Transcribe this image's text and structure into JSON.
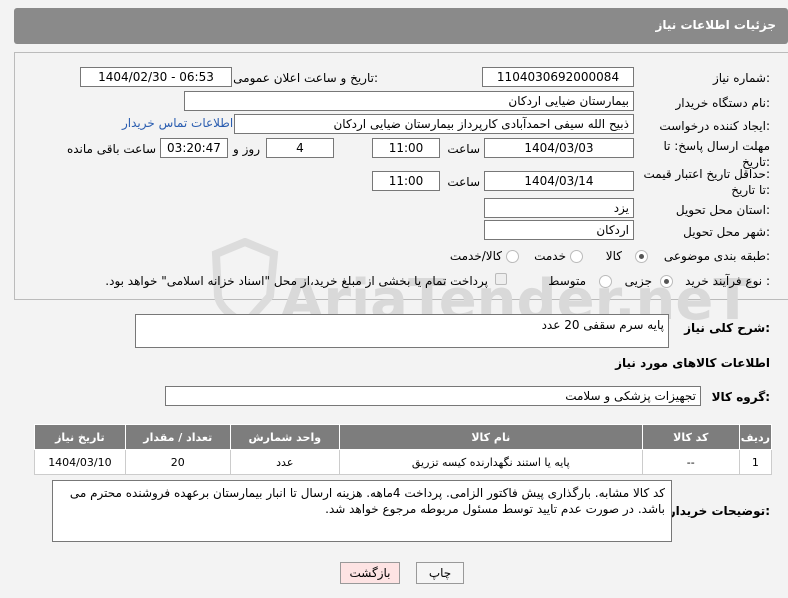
{
  "header": {
    "title": "جزئیات اطلاعات نیاز"
  },
  "fields": {
    "need_number_label": "شماره نیاز:",
    "need_number": "1104030692000084",
    "announce_label": "تاریخ و ساعت اعلان عمومی:",
    "announce_value": "1404/02/30 - 06:53",
    "buyer_org_label": "نام دستگاه خریدار:",
    "buyer_org": "بیمارستان ضیایی اردکان",
    "creator_label": "ایجاد کننده درخواست:",
    "creator": "ذبیح الله سیفی احمدآبادی کارپرداز بیمارستان ضیایی اردکان",
    "contact_link": "اطلاعات تماس خریدار",
    "deadline_label_1": "مهلت ارسال پاسخ: تا",
    "deadline_label_2": "تاریخ:",
    "deadline_date": "1404/03/03",
    "time_label": "ساعت",
    "deadline_time": "11:00",
    "days_value": "4",
    "days_label": "روز و",
    "remaining_value": "03:20:47",
    "remaining_label": "ساعت باقی مانده",
    "validity_label_1": "حداقل تاریخ اعتبار قیمت:",
    "validity_label_2": "تا تاریخ:",
    "validity_date": "1404/03/14",
    "validity_time": "11:00",
    "province_label": "استان محل تحویل:",
    "province": "یزد",
    "city_label": "شهر محل تحویل:",
    "city": "اردکان",
    "category_label": "طبقه بندی موضوعی:",
    "category_options": [
      "کالا",
      "خدمت",
      "کالا/خدمت"
    ],
    "process_label": "نوع فرآیند خرید :",
    "process_options": [
      "جزیی",
      "متوسط"
    ],
    "payment_note": "پرداخت تمام یا بخشی از مبلغ خرید،از محل \"اسناد خزانه اسلامی\" خواهد بود."
  },
  "description": {
    "label": "شرح کلی نیاز:",
    "value": "پایه سرم سقفی 20 عدد"
  },
  "goods_section": {
    "title": "اطلاعات کالاهای مورد نیاز",
    "group_label": "گروه کالا:",
    "group_value": "تجهیزات پزشکی و سلامت"
  },
  "table": {
    "headers": [
      "ردیف",
      "کد کالا",
      "نام کالا",
      "واحد شمارش",
      "تعداد / مقدار",
      "تاریخ نیاز"
    ],
    "rows": [
      [
        "1",
        "--",
        "پایه یا استند نگهدارنده کیسه تزریق",
        "عدد",
        "20",
        "1404/03/10"
      ]
    ]
  },
  "buyer_notes": {
    "label": "توضیحات خریدار:",
    "value": "کد کالا مشابه. بارگذاری پیش فاکتور الزامی. پرداخت 4ماهه. هزینه ارسال تا انبار بیمارستان برعهده فروشنده محترم می باشد. در صورت عدم تایید توسط مسئول مربوطه مرجوع خواهد شد."
  },
  "buttons": {
    "print": "چاپ",
    "back": "بازگشت"
  },
  "watermark": "AriaTender.neT"
}
